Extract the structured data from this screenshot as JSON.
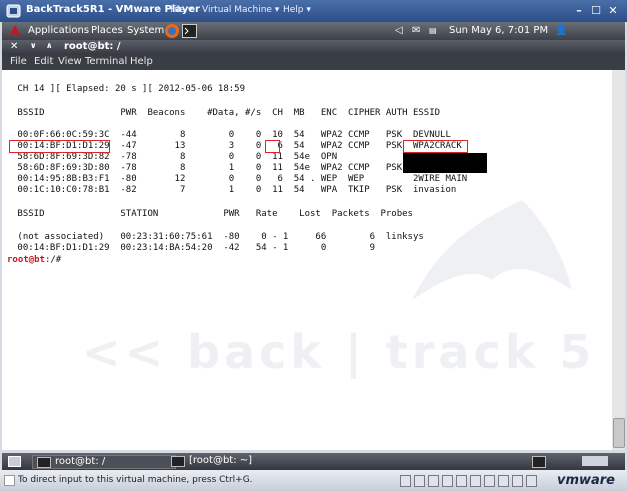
{
  "vm": {
    "title": "BackTrack5R1 - VMware Player",
    "menus": [
      "File ▾",
      "Virtual Machine ▾",
      "Help ▾"
    ],
    "status_text": "To direct input to this virtual machine, press Ctrl+G.",
    "brand": "vmware"
  },
  "gnome": {
    "applications": "Applications",
    "places": "Places",
    "system": "System",
    "clock": "Sun May  6,  7:01 PM"
  },
  "terminal": {
    "title": "root@bt: /",
    "menu": [
      "File",
      "Edit",
      "View",
      "Terminal",
      "Help"
    ],
    "lines": [
      " CH 14 ][ Elapsed: 20 s ][ 2012-05-06 18:59",
      "",
      " BSSID              PWR  Beacons    #Data, #/s  CH  MB   ENC  CIPHER AUTH ESSID",
      "",
      " 00:0F:66:0C:59:3C  -44        8        0    0  10  54   WPA2 CCMP   PSK  DEVNULL",
      " 00:14:BF:D1:D1:29  -47       13        3    0   6  54   WPA2 CCMP   PSK  WPA2CRACK",
      " 58:6D:8F:69:3D:82  -78        8        0    0  11  54e  OPN",
      " 58:6D:8F:69:3D:80  -78        8        1    0  11  54e  WPA2 CCMP   PSK",
      " 00:14:95:8B:B3:F1  -80       12        0    0   6  54 . WEP  WEP         2WIRE MAIN",
      " 00:1C:10:C0:78:B1  -82        7        1    0  11  54   WPA  TKIP   PSK  invasion",
      "",
      " BSSID              STATION            PWR   Rate    Lost  Packets  Probes",
      "",
      " (not associated)   00:23:31:60:75:61  -80    0 - 1     66        6  linksys",
      " 00:14:BF:D1:D1:29  00:23:14:BA:54:20  -42   54 - 1      0        9"
    ],
    "prompt_user": "root@bt",
    "prompt_rest": ":/#",
    "background_text": "<< back | track 5"
  },
  "taskbar": {
    "items": [
      "root@bt: /",
      "[root@bt: ~]"
    ]
  }
}
